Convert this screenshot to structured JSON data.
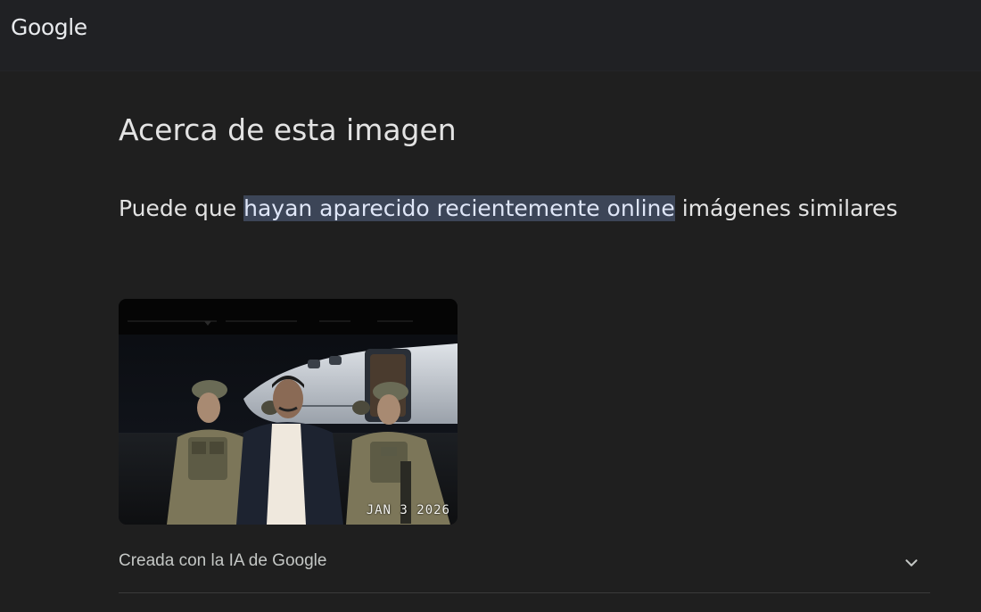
{
  "header": {
    "logo_text": "Google"
  },
  "main": {
    "title": "Acerca de esta imagen",
    "subtitle_prefix": "Puede que ",
    "subtitle_highlight": "hayan aparecido recientemente online",
    "subtitle_suffix": " imágenes similares",
    "image": {
      "date_stamp": "JAN 3 2026"
    },
    "ai_row": {
      "label": "Creada con la IA de Google",
      "icon": "chevron-down-icon"
    }
  },
  "colors": {
    "background": "#1f1f1f",
    "header_background": "#202124",
    "highlight": "#3c4557",
    "text": "#e3e3e3",
    "secondary_text": "#c4c7c5"
  }
}
